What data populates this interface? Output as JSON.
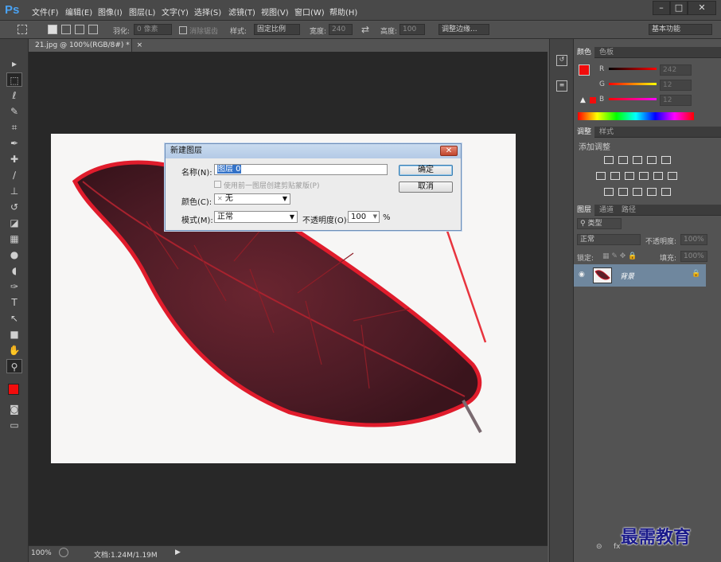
{
  "app": {
    "logo": "Ps",
    "menu": [
      "文件(F)",
      "编辑(E)",
      "图像(I)",
      "图层(L)",
      "文字(Y)",
      "选择(S)",
      "滤镜(T)",
      "视图(V)",
      "窗口(W)",
      "帮助(H)"
    ],
    "window_controls": [
      "–",
      "□",
      "✕"
    ]
  },
  "options_bar": {
    "feather_label": "羽化:",
    "feather_value": "0 像素",
    "antialias_label": "消除锯齿",
    "style_label": "样式:",
    "style_value": "固定比例",
    "width_label": "宽度:",
    "width_value": "240",
    "height_label": "高度:",
    "height_value": "100",
    "refine_edge": "调整边缘...",
    "workspace": "基本功能"
  },
  "document": {
    "tab_title": "21.jpg @ 100%(RGB/8#) *",
    "tab_close": "×"
  },
  "status_bar": {
    "zoom": "100%",
    "doc_info": "文档:1.24M/1.19M"
  },
  "dialog": {
    "title": "新建图层",
    "close": "✕",
    "name_label": "名称(N):",
    "name_value": "图层 0",
    "clip_label": "使用前一图层创建剪贴蒙版(P)",
    "color_label": "颜色(C):",
    "color_value": "无",
    "color_icon": "✕",
    "mode_label": "模式(M):",
    "mode_value": "正常",
    "opacity_label": "不透明度(O):",
    "opacity_value": "100",
    "opacity_unit": "%",
    "ok_label": "确定",
    "cancel_label": "取消"
  },
  "color_panel": {
    "tabs": [
      "颜色",
      "色板"
    ],
    "r_label": "R",
    "r_value": "242",
    "g_label": "G",
    "g_value": "12",
    "b_label": "B",
    "b_value": "12",
    "foreground_color": "#f20c0c"
  },
  "adjust_panel": {
    "tabs": [
      "调整",
      "样式"
    ],
    "heading": "添加调整"
  },
  "layers_panel": {
    "tabs": [
      "图层",
      "通道",
      "路径"
    ],
    "filter_label": "类型",
    "blend_mode": "正常",
    "opacity_label": "不透明度:",
    "opacity_value": "100%",
    "lock_label": "锁定:",
    "fill_label": "填充:",
    "fill_value": "100%",
    "layer_name": "背景"
  },
  "watermark": "最需教育"
}
